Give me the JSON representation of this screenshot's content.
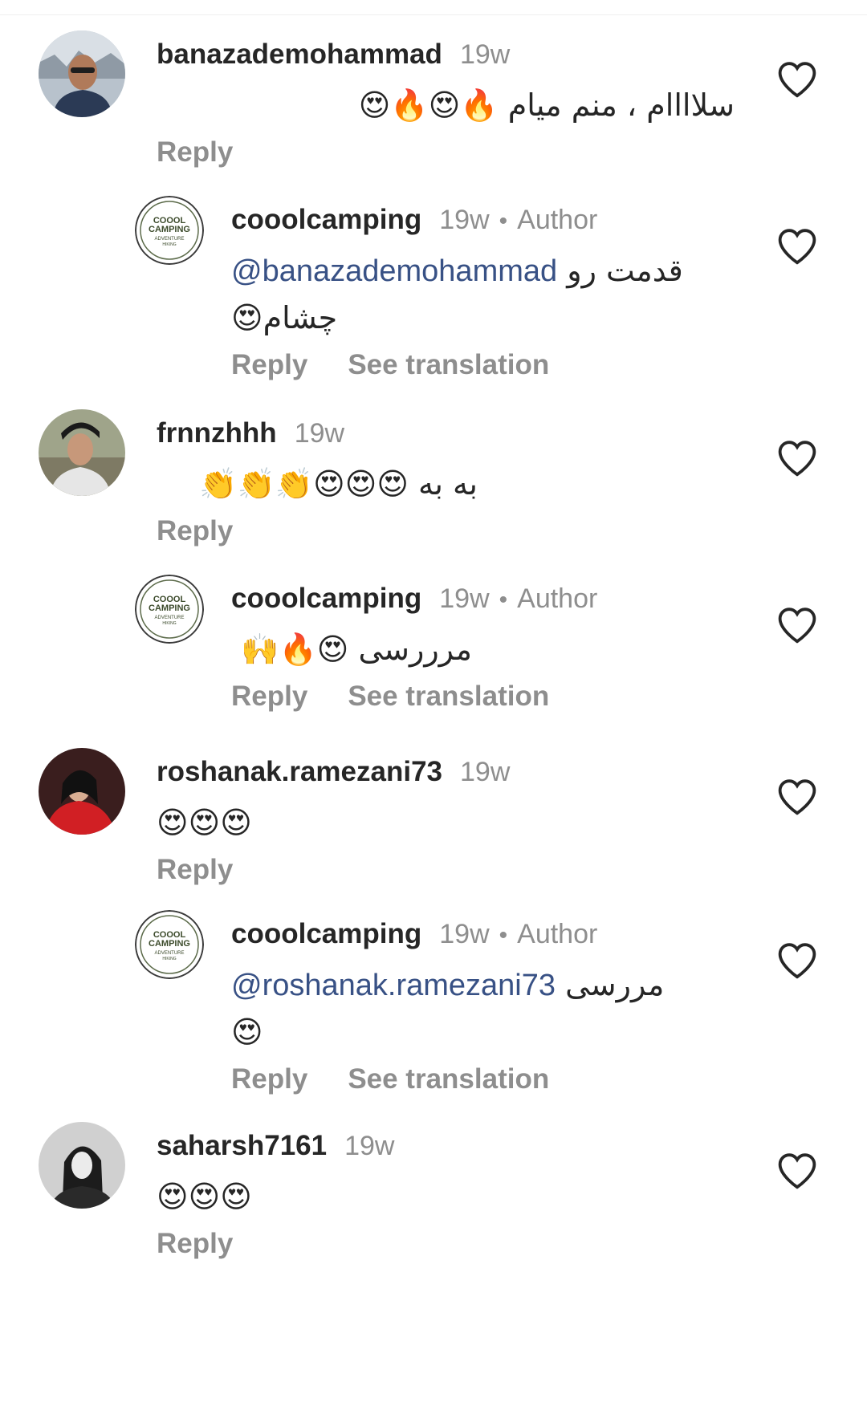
{
  "comments": [
    {
      "username": "banazademohammad",
      "time": "19w",
      "text": "سلاااام ، منم میام 🔥😍🔥😍",
      "actions": {
        "reply": "Reply"
      }
    },
    {
      "username": "cooolcamping",
      "time": "19w",
      "author_label": "Author",
      "dot": "•",
      "mention": "@banazademohammad",
      "text": "قدمت رو",
      "text_line2": "چشام😍",
      "actions": {
        "reply": "Reply",
        "translate": "See translation"
      }
    },
    {
      "username": "frnnzhhh",
      "time": "19w",
      "text": "به به 😍😍😍👏👏👏",
      "actions": {
        "reply": "Reply"
      }
    },
    {
      "username": "cooolcamping",
      "time": "19w",
      "author_label": "Author",
      "dot": "•",
      "text": "مرررسی 😍🔥🙌",
      "actions": {
        "reply": "Reply",
        "translate": "See translation"
      }
    },
    {
      "username": "roshanak.ramezani73",
      "time": "19w",
      "text": "😍😍😍",
      "actions": {
        "reply": "Reply"
      }
    },
    {
      "username": "cooolcamping",
      "time": "19w",
      "author_label": "Author",
      "dot": "•",
      "mention": "@roshanak.ramezani73",
      "text": "مررسی",
      "text_line2": "😍",
      "actions": {
        "reply": "Reply",
        "translate": "See translation"
      }
    },
    {
      "username": "saharsh7161",
      "time": "19w",
      "text": "😍😍😍",
      "actions": {
        "reply": "Reply"
      }
    }
  ],
  "logo": {
    "line1": "COOOL",
    "line2": "CAMPING",
    "line3": "ADVENTURE",
    "line4": "HIKING"
  },
  "colors": {
    "link": "#385185",
    "muted": "#8e8e8e",
    "text": "#262626"
  },
  "icons": {
    "like": "heart-outline-icon"
  }
}
